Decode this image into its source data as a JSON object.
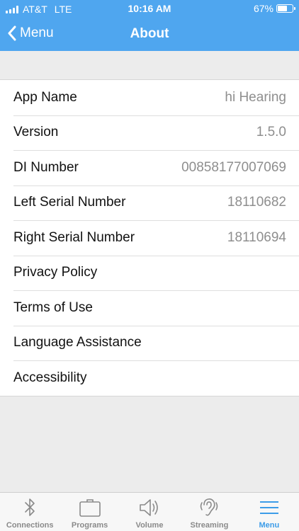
{
  "status_bar": {
    "carrier": "AT&T",
    "network": "LTE",
    "time": "10:16 AM",
    "battery_percent": "67%",
    "battery_level": 0.67
  },
  "nav": {
    "back_label": "Menu",
    "title": "About"
  },
  "about_rows": [
    {
      "label": "App Name",
      "value": "hi Hearing"
    },
    {
      "label": "Version",
      "value": "1.5.0"
    },
    {
      "label": "DI Number",
      "value": "00858177007069"
    },
    {
      "label": "Left Serial Number",
      "value": "18110682"
    },
    {
      "label": "Right Serial Number",
      "value": "18110694"
    },
    {
      "label": "Privacy Policy",
      "value": ""
    },
    {
      "label": "Terms of Use",
      "value": ""
    },
    {
      "label": "Language Assistance",
      "value": ""
    },
    {
      "label": "Accessibility",
      "value": ""
    }
  ],
  "tabs": [
    {
      "label": "Connections",
      "icon": "bluetooth-icon"
    },
    {
      "label": "Programs",
      "icon": "briefcase-icon"
    },
    {
      "label": "Volume",
      "icon": "speaker-icon"
    },
    {
      "label": "Streaming",
      "icon": "ear-icon"
    },
    {
      "label": "Menu",
      "icon": "hamburger-menu-icon",
      "active": true
    }
  ],
  "colors": {
    "header": "#4fa6ef",
    "active_tab": "#3d9ce8",
    "value_text": "#8e8e8e"
  }
}
